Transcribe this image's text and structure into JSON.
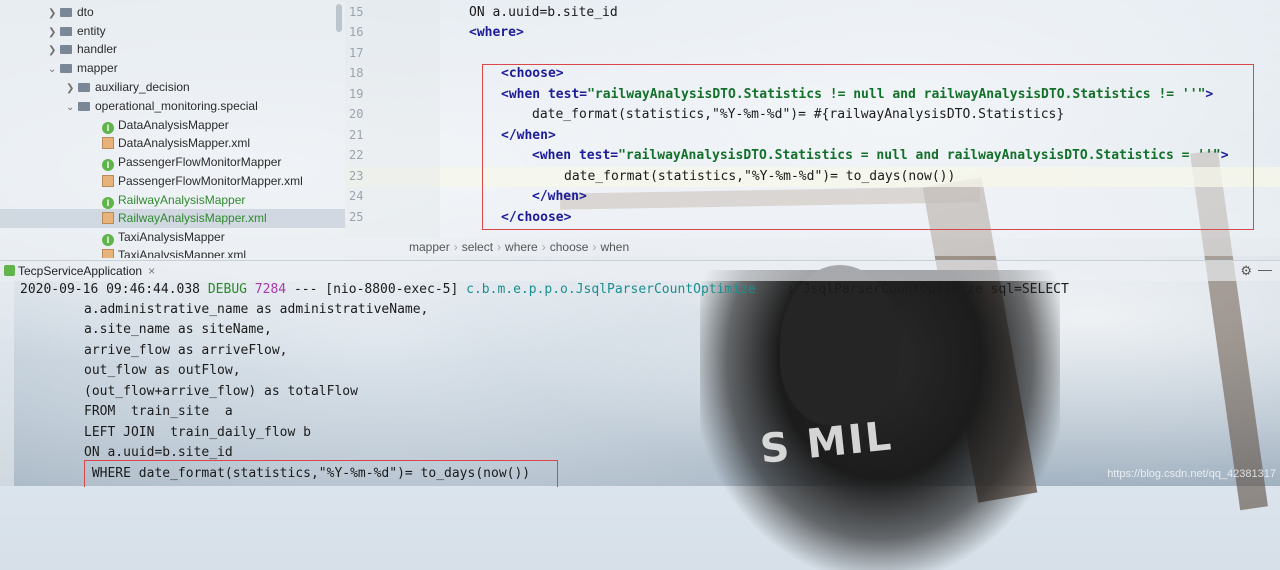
{
  "project_tree": {
    "items": [
      {
        "label": "dto",
        "level": 1,
        "type": "folder",
        "expanded": false
      },
      {
        "label": "entity",
        "level": 1,
        "type": "folder",
        "expanded": false
      },
      {
        "label": "handler",
        "level": 1,
        "type": "folder",
        "expanded": false
      },
      {
        "label": "mapper",
        "level": 1,
        "type": "folder",
        "expanded": true
      },
      {
        "label": "auxiliary_decision",
        "level": 2,
        "type": "folder",
        "expanded": false
      },
      {
        "label": "operational_monitoring.special",
        "level": 2,
        "type": "folder",
        "expanded": true
      },
      {
        "label": "DataAnalysisMapper",
        "level": 3,
        "type": "interface"
      },
      {
        "label": "DataAnalysisMapper.xml",
        "level": 3,
        "type": "xml"
      },
      {
        "label": "PassengerFlowMonitorMapper",
        "level": 3,
        "type": "interface"
      },
      {
        "label": "PassengerFlowMonitorMapper.xml",
        "level": 3,
        "type": "xml"
      },
      {
        "label": "RailwayAnalysisMapper",
        "level": 3,
        "type": "interface",
        "vcs": "added"
      },
      {
        "label": "RailwayAnalysisMapper.xml",
        "level": 3,
        "type": "xml",
        "vcs": "added",
        "selected": true
      },
      {
        "label": "TaxiAnalysisMapper",
        "level": 3,
        "type": "interface"
      },
      {
        "label": "TaxiAnalysisMapper.xml",
        "level": 3,
        "type": "xml"
      }
    ]
  },
  "editor": {
    "line_numbers": [
      "15",
      "16",
      "17",
      "18",
      "19",
      "20",
      "21",
      "22",
      "23",
      "24",
      "25"
    ],
    "lines": {
      "l15": "ON a.uuid=b.site_id",
      "l16_tag": "<where>",
      "l18_tag": "<choose>",
      "l19_open": "<when ",
      "l19_attr": "test=",
      "l19_val": "\"railwayAnalysisDTO.Statistics != null and railwayAnalysisDTO.Statistics != ''\"",
      "l19_close": ">",
      "l20": "date_format(statistics,\"%Y-%m-%d\")= #{railwayAnalysisDTO.Statistics}",
      "l21_tag": "</when>",
      "l22_open": "<when ",
      "l22_attr": "test=",
      "l22_val": "\"railwayAnalysisDTO.Statistics = null and railwayAnalysisDTO.Statistics = ''\"",
      "l22_close": ">",
      "l23": "date_format(statistics,\"%Y-%m-%d\")= to_days(now())",
      "l24_tag": "</when>",
      "l25_tag": "</choose>"
    },
    "breadcrumbs": [
      "mapper",
      "select",
      "where",
      "choose",
      "when"
    ]
  },
  "run_panel": {
    "tab_label": "TecpServiceApplication",
    "console": {
      "l1_ts": "2020-09-16 09:46:44.038 ",
      "l1_level": "DEBUG",
      "l1_pid": " 7284",
      "l1_mid": " --- [nio-8800-exec-5] ",
      "l1_logger": "c.b.m.e.p.p.o.JsqlParserCountOptimize",
      "l1_msg": "    : JsqlParserCountOptimize sql=SELECT",
      "sql_lines": [
        "a.administrative_name as administrativeName,",
        "a.site_name as siteName,",
        "arrive_flow as arriveFlow,",
        "out_flow as outFlow,",
        "(out_flow+arrive_flow) as totalFlow",
        "FROM  train_site  a",
        "LEFT JOIN  train_daily_flow b",
        "ON a.uuid=b.site_id",
        " WHERE date_format(statistics,\"%Y-%m-%d\")= to_days(now())"
      ]
    }
  },
  "watermark": "https://blog.csdn.net/qq_42381317",
  "background_text": "S MIL",
  "colors": {
    "debug": "#2a8a2a",
    "pid": "#a83aa8",
    "logger": "#1b8f8f",
    "xml_tag": "#1c1c98",
    "xml_string": "#13702a",
    "highlight_box": "#d84848",
    "vcs_added": "#2f8a2f"
  }
}
